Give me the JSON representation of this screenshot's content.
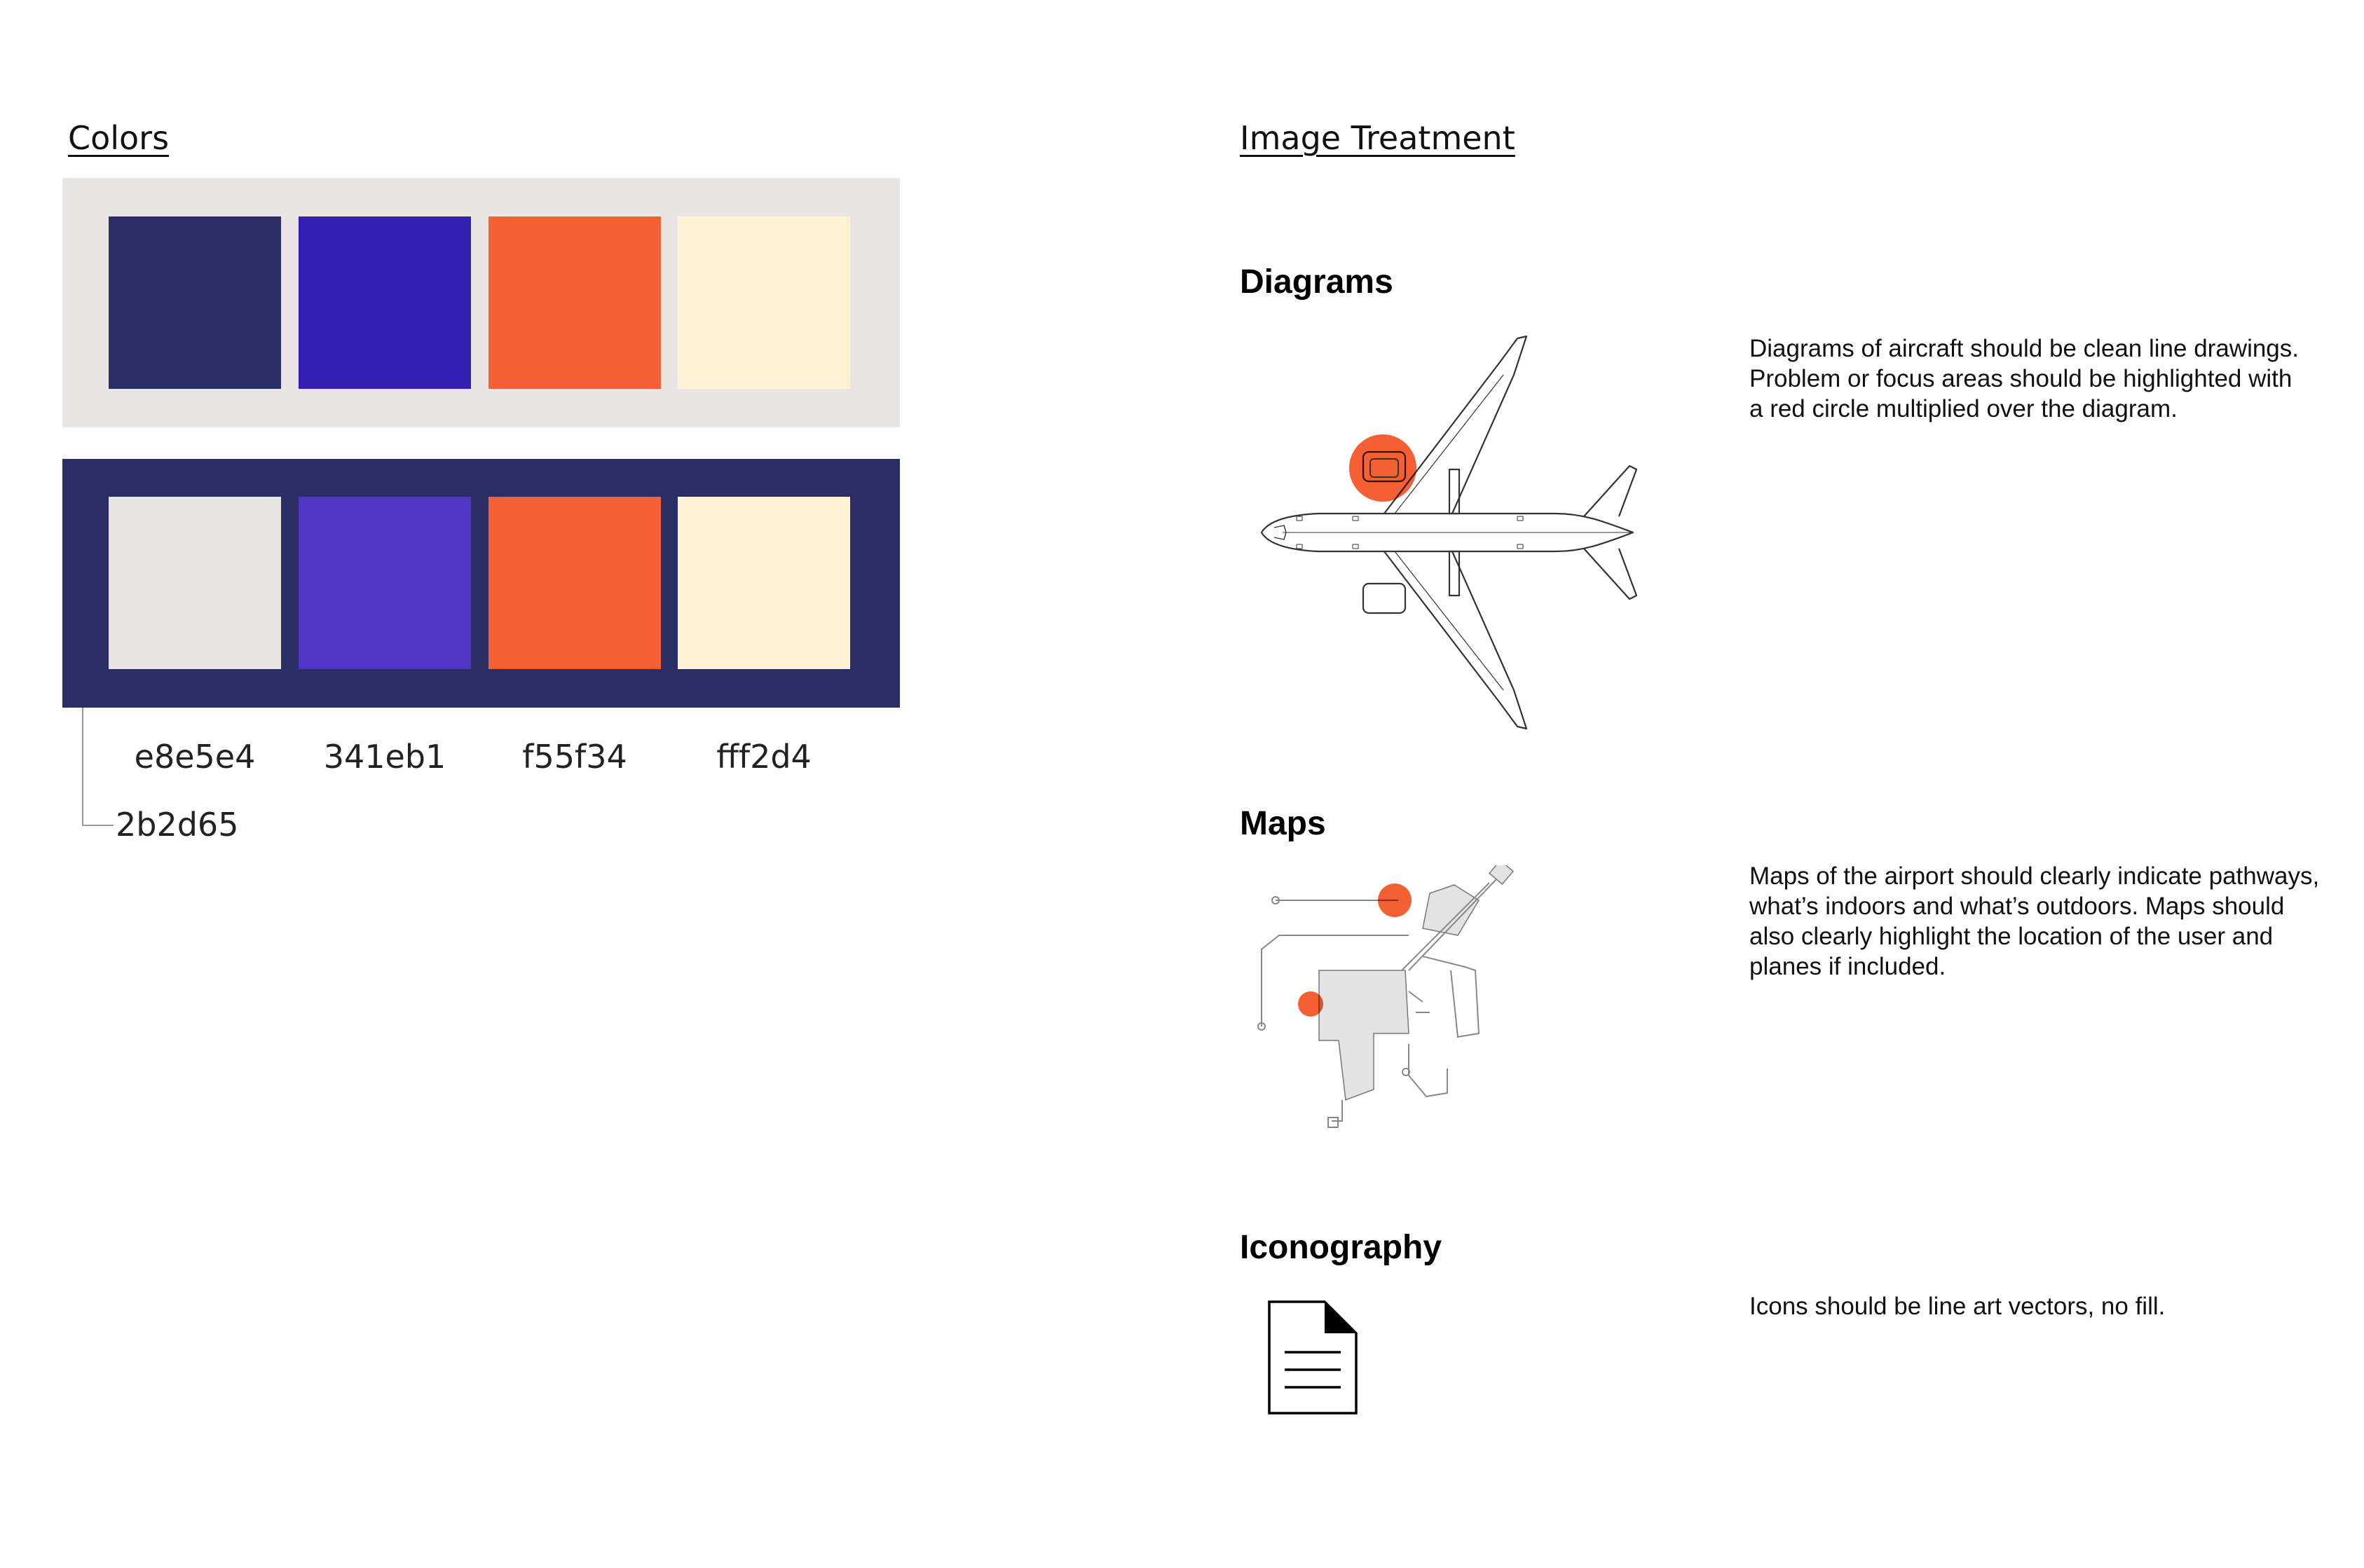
{
  "colors": {
    "title": "Colors",
    "light_panel": {
      "background": "#e8e5e4",
      "swatches": [
        "#2b2d65",
        "#341eb1",
        "#f55f34",
        "#fff2d4"
      ]
    },
    "dark_panel": {
      "background": "#2b2d65",
      "swatches": [
        "#e8e5e4",
        "#4f37c4",
        "#f55f34",
        "#fff2d4"
      ]
    },
    "hex_labels": [
      "e8e5e4",
      "341eb1",
      "f55f34",
      "fff2d4"
    ],
    "dark_label": "2b2d65"
  },
  "image_treatment": {
    "title": "Image Treatment",
    "diagrams": {
      "heading": "Diagrams",
      "icon": "airplane-line-diagram",
      "highlight_color": "#f55f34",
      "description_lines": [
        "Diagrams of aircraft should be clean line drawings.",
        "Problem or focus areas should be highlighted with",
        "a red circle multiplied over the diagram."
      ]
    },
    "maps": {
      "heading": "Maps",
      "icon": "airport-map",
      "description_lines": [
        "Maps of the airport should clearly indicate pathways,",
        "what’s indoors and what’s outdoors. Maps should",
        "also clearly highlight the location of the user and",
        "planes if included."
      ]
    },
    "iconography": {
      "heading": "Iconography",
      "icon": "document-icon",
      "description_lines": [
        "Icons should be line art vectors, no fill."
      ]
    }
  }
}
